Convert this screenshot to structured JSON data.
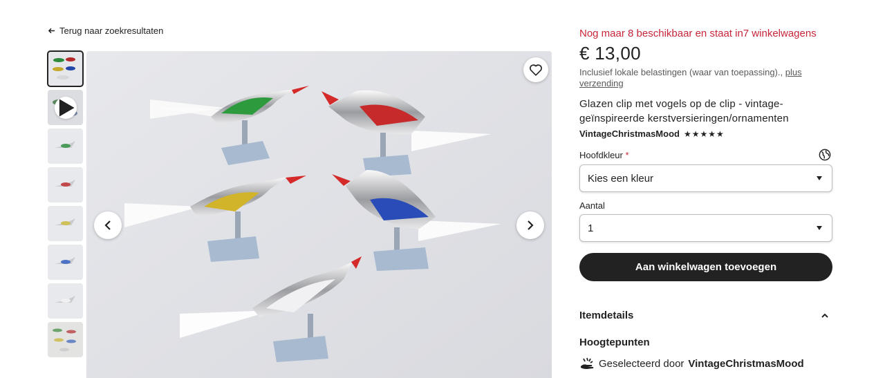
{
  "nav": {
    "back_label": "Terug naar zoekresultaten"
  },
  "gallery": {
    "thumbnails": [
      {
        "kind": "photo",
        "active": true
      },
      {
        "kind": "video",
        "active": false
      },
      {
        "kind": "photo",
        "active": false
      },
      {
        "kind": "photo",
        "active": false
      },
      {
        "kind": "photo",
        "active": false
      },
      {
        "kind": "photo",
        "active": false
      },
      {
        "kind": "photo",
        "active": false
      },
      {
        "kind": "photo",
        "active": false
      }
    ],
    "icons": {
      "favorite": "heart-icon",
      "prev": "chevron-left-icon",
      "next": "chevron-right-icon",
      "video": "play-icon"
    }
  },
  "listing": {
    "stock_notice": "Nog maar 8 beschikbaar en staat in7 winkelwagens",
    "price": "€ 13,00",
    "tax_note": "Inclusief lokale belastingen (waar van toepassing).,",
    "shipping_link": "plus verzending",
    "title": "Glazen clip met vogels op de clip - vintage-geïnspireerde kerstversieringen/ornamenten",
    "shop_name": "VintageChristmasMood",
    "rating_stars": "★★★★★"
  },
  "options": {
    "color_label": "Hoofdkleur",
    "required_mark": "*",
    "color_value": "Kies een kleur",
    "quantity_label": "Aantal",
    "quantity_value": "1"
  },
  "actions": {
    "add_to_cart": "Aan winkelwagen toevoegen"
  },
  "details": {
    "heading": "Itemdetails",
    "highlights_heading": "Hoogtepunten",
    "selected_by_prefix": "Geselecteerd door",
    "selected_by_shop": "VintageChristmasMood"
  },
  "colors": {
    "alert": "#c8253a",
    "primary_button": "#222222",
    "text": "#222222",
    "muted": "#595959"
  }
}
